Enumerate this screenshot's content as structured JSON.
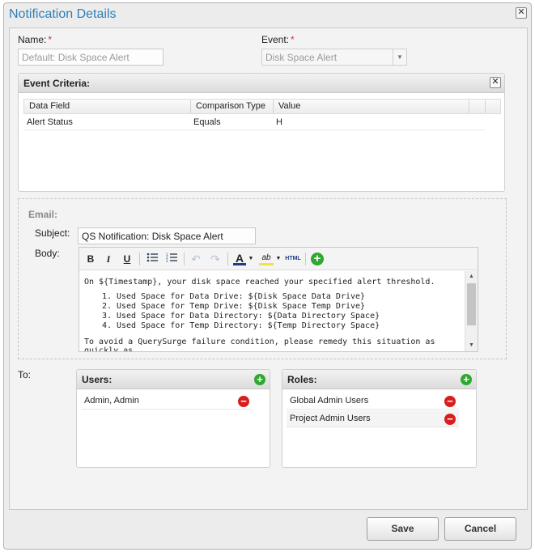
{
  "dialog": {
    "title": "Notification Details"
  },
  "form": {
    "name_label": "Name:",
    "name_value": "Default: Disk Space Alert",
    "event_label": "Event:",
    "event_value": "Disk Space Alert",
    "required_mark": "*"
  },
  "criteria": {
    "title": "Event Criteria:",
    "columns": [
      "Data Field",
      "Comparison Type",
      "Value"
    ],
    "rows": [
      {
        "data_field": "Alert Status",
        "comparison": "Equals",
        "value": "H"
      }
    ]
  },
  "email": {
    "section_label": "Email:",
    "subject_label": "Subject:",
    "subject_value": "QS Notification: Disk Space Alert",
    "body_label": "Body:",
    "toolbar": {
      "bold": "B",
      "italic": "I",
      "underline": "U",
      "text_color": "A",
      "highlight": "ab",
      "html": "HTML"
    },
    "body": {
      "intro": "On ${Timestamp}, your disk space reached your specified alert threshold.",
      "items": [
        "Used Space for Data Drive: ${Disk Space Data Drive}",
        "Used Space for Temp Drive: ${Disk Space Temp Drive}",
        "Used Space for Data Directory: ${Data Directory Space}",
        "Used Space for Temp Directory: ${Temp Directory Space}"
      ],
      "outro": "To avoid a QuerySurge failure condition, please remedy this situation as quickly as"
    }
  },
  "recipients": {
    "to_label": "To:",
    "users": {
      "title": "Users:",
      "items": [
        "Admin, Admin"
      ]
    },
    "roles": {
      "title": "Roles:",
      "items": [
        "Global Admin Users",
        "Project Admin Users"
      ]
    }
  },
  "buttons": {
    "save": "Save",
    "cancel": "Cancel"
  },
  "colors": {
    "title": "#2f7fb7",
    "add": "#2fa82f",
    "remove": "#d81e1e",
    "required": "#d32f2f"
  }
}
